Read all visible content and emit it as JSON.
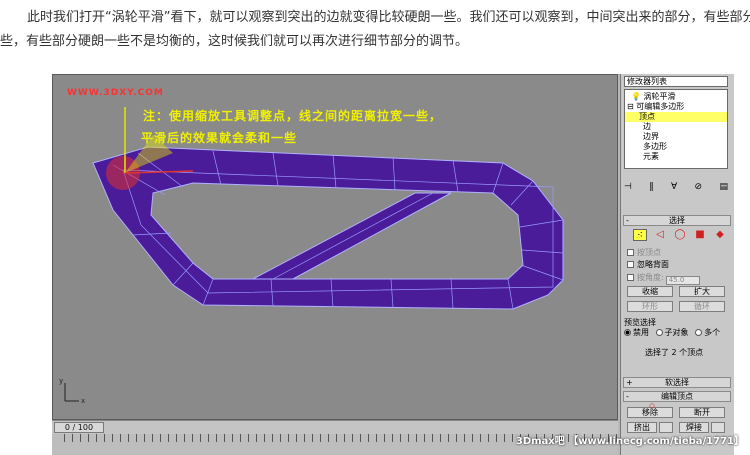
{
  "article": {
    "line1": "此时我们打开“涡轮平滑”看下，就可以观察到突出的边就变得比较硬朗一些。我们还可以观察到，中间突出来的部分，有些部分索",
    "line2": "些，有些部分硬朗一些不是均衡的，这时候我们就可以再次进行细节部分的调节。"
  },
  "viewport": {
    "watermark_site": "WWW.3DXY.COM",
    "annotation_line1": "注：使用缩放工具调整点，线之间的距离拉宽一些，",
    "annotation_line2": "平滑后的效果就会柔和一些",
    "axis_y": "y",
    "axis_x": "x",
    "colors": {
      "mesh_fill": "#4a1c9a",
      "mesh_edge": "#b0b0ff",
      "highlight": "#e03030",
      "background": "#8a8a8a"
    }
  },
  "timeline": {
    "frame_readout": "0 / 100"
  },
  "panel": {
    "modifier_list": "修改器列表",
    "stack": [
      {
        "label": "涡轮平滑",
        "icon": "bulb-icon"
      },
      {
        "label": "可编辑多边形",
        "icon": "expand-icon"
      },
      {
        "label": "顶点",
        "selected": true
      },
      {
        "label": "边"
      },
      {
        "label": "边界"
      },
      {
        "label": "多边形"
      },
      {
        "label": "元素"
      }
    ],
    "select_rollout": "选择",
    "by_vertex": "按顶点",
    "ignore_backfacing": "忽略背面",
    "by_angle": "按角度:",
    "angle_value": "45.0",
    "shrink": "收缩",
    "grow": "扩大",
    "ring": "环形",
    "loop": "循环",
    "preview_selection": "预览选择",
    "disabled": "禁用",
    "sub_object": "子对象",
    "multi": "多个",
    "status": "选择了 2 个顶点",
    "soft_selection": "软选择",
    "edit_vertices": "编辑顶点",
    "remove": "移除",
    "break": "断开",
    "extrude": "挤出",
    "weld": "焊接"
  },
  "footer": {
    "watermark": "3Dmax吧 【www.linecg.com/tieba/1771】"
  }
}
